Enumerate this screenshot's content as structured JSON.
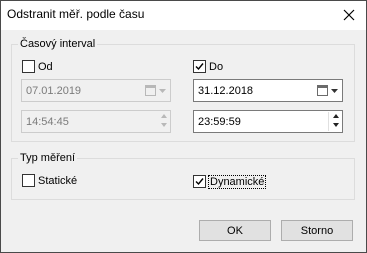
{
  "window": {
    "title": "Odstranit měř. podle času",
    "close_icon": "close-icon"
  },
  "time_interval": {
    "label": "Časový interval",
    "from": {
      "label": "Od",
      "checked": false,
      "date": "07.01.2019",
      "time": "14:54:45",
      "enabled": false
    },
    "to": {
      "label": "Do",
      "checked": true,
      "date": "31.12.2018",
      "time": "23:59:59",
      "enabled": true
    }
  },
  "measurement_type": {
    "label": "Typ měření",
    "static": {
      "label": "Statické",
      "checked": false
    },
    "dynamic": {
      "label": "Dynamické",
      "checked": true
    }
  },
  "buttons": {
    "ok": "OK",
    "cancel": "Storno"
  },
  "colors": {
    "dialog_bg": "#f0f0f0",
    "titlebar_bg": "#ffffff",
    "button_bg": "#e1e1e1"
  }
}
